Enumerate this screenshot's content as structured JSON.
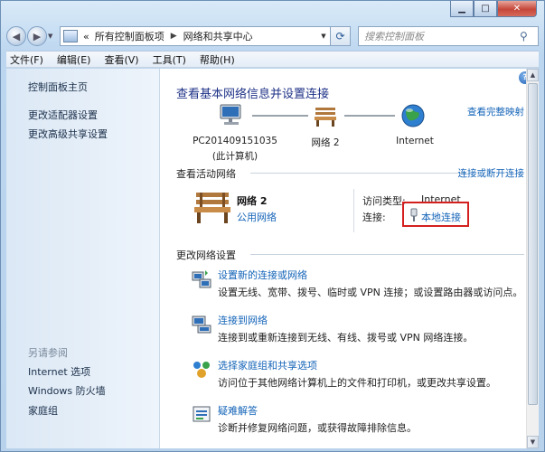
{
  "address": {
    "overflow": "«",
    "crumbs": [
      "所有控制面板项",
      "网络和共享中心"
    ],
    "search_placeholder": "搜索控制面板"
  },
  "menu": [
    "文件(F)",
    "编辑(E)",
    "查看(V)",
    "工具(T)",
    "帮助(H)"
  ],
  "sidebar": {
    "links": [
      "控制面板主页",
      "更改适配器设置",
      "更改高级共享设置"
    ],
    "see_also_title": "另请参阅",
    "see_also": [
      "Internet 选项",
      "Windows 防火墙",
      "家庭组"
    ]
  },
  "main": {
    "title": "查看基本网络信息并设置连接",
    "view_full_map": "查看完整映射",
    "map": {
      "computer_name": "PC201409151035",
      "computer_sub": "(此计算机)",
      "network": "网络  2",
      "internet": "Internet"
    },
    "active": {
      "heading": "查看活动网络",
      "connect_disconnect": "连接或断开连接",
      "network_name": "网络  2",
      "network_type": "公用网络",
      "access_label": "访问类型:",
      "access_value": "Internet",
      "conn_label": "连接:",
      "conn_value": "本地连接"
    },
    "change": {
      "heading": "更改网络设置",
      "tasks": [
        {
          "title": "设置新的连接或网络",
          "desc": "设置无线、宽带、拨号、临时或 VPN 连接；或设置路由器或访问点。"
        },
        {
          "title": "连接到网络",
          "desc": "连接到或重新连接到无线、有线、拨号或 VPN 网络连接。"
        },
        {
          "title": "选择家庭组和共享选项",
          "desc": "访问位于其他网络计算机上的文件和打印机，或更改共享设置。"
        },
        {
          "title": "疑难解答",
          "desc": "诊断并修复网络问题，或获得故障排除信息。"
        }
      ]
    }
  }
}
